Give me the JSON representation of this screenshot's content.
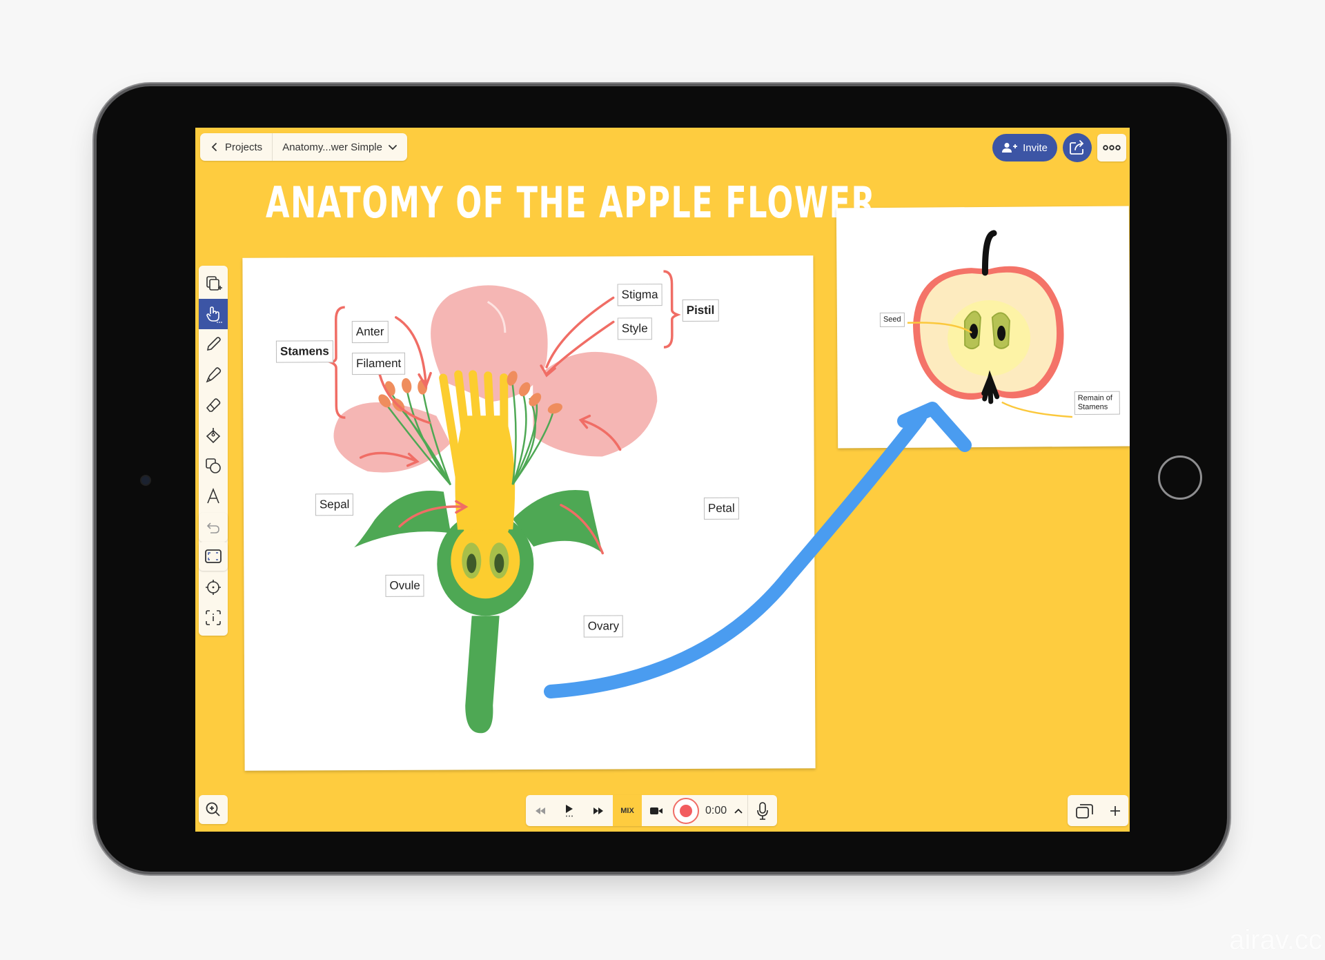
{
  "nav": {
    "back_label": "Projects",
    "document_name": "Anatomy...wer Simple"
  },
  "actions": {
    "invite_label": "Invite",
    "share_icon": "share-icon",
    "more_icon": "more-icon"
  },
  "board": {
    "title": "ANATOMY OF THE APPLE FLOWER"
  },
  "toolbar": {
    "tools": [
      {
        "name": "add-page",
        "icon": "add-page-icon"
      },
      {
        "name": "hand",
        "icon": "hand-pointer-icon",
        "active": true
      },
      {
        "name": "pencil",
        "icon": "pencil-icon"
      },
      {
        "name": "marker",
        "icon": "highlighter-icon"
      },
      {
        "name": "eraser",
        "icon": "eraser-icon"
      },
      {
        "name": "fill",
        "icon": "paint-bucket-icon"
      },
      {
        "name": "shapes",
        "icon": "shapes-icon"
      },
      {
        "name": "text",
        "icon": "text-icon"
      },
      {
        "name": "select",
        "icon": "lasso-select-icon"
      },
      {
        "name": "delete",
        "icon": "x-icon"
      },
      {
        "name": "laser",
        "icon": "crosshair-icon"
      },
      {
        "name": "info",
        "icon": "info-frame-icon"
      }
    ],
    "undo_icon": "undo-icon",
    "frame_icon": "frame-icon"
  },
  "flower_diagram": {
    "labels": {
      "stamens": "Stamens",
      "anter": "Anter",
      "filament": "Filament",
      "stigma": "Stigma",
      "style": "Style",
      "pistil": "Pistil",
      "sepal": "Sepal",
      "petal": "Petal",
      "ovule": "Ovule",
      "ovary": "Ovary"
    },
    "colors": {
      "petal": "#f5b6b4",
      "leaf": "#4ea854",
      "pistil": "#fccd2f",
      "anther": "#ef8d5d",
      "arrow": "#f06d65"
    }
  },
  "apple_diagram": {
    "labels": {
      "seed": "Seed",
      "remain_of_stamens": "Remain of Stamens"
    },
    "colors": {
      "skin": "#f47368",
      "flesh": "#fdebbf",
      "core": "#fdf3a6",
      "seed_pod": "#b6c254",
      "arrow": "#fbc83c"
    }
  },
  "connector_arrow_color": "#4a9cf0",
  "playback": {
    "rewind_icon": "rewind-icon",
    "play_icon": "play-icon",
    "forward_icon": "fast-forward-icon",
    "mix_label": "MIX",
    "camera_icon": "video-camera-icon",
    "record_icon": "record-icon",
    "time": "0:00",
    "expand_icon": "chevron-up-icon",
    "mic_icon": "microphone-icon"
  },
  "bottom_right": {
    "pages_icon": "pages-icon",
    "add_icon": "plus-icon"
  },
  "zoom_icon": "zoom-in-icon",
  "watermark": "airav.cc",
  "accent_color": "#3c55a5",
  "canvas_color": "#fecc3f"
}
